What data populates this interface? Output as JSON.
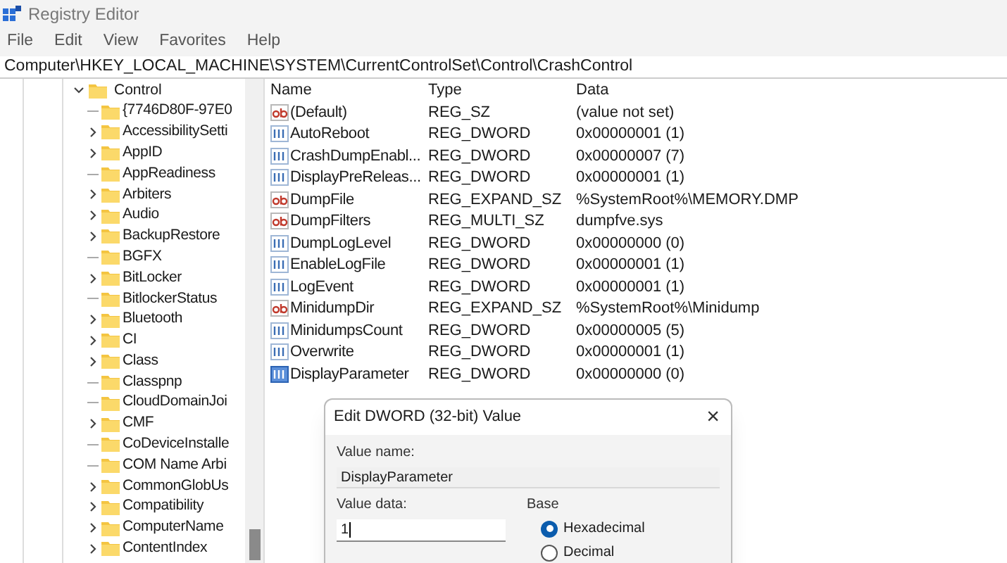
{
  "window": {
    "title": "Registry Editor"
  },
  "menu": [
    "File",
    "Edit",
    "View",
    "Favorites",
    "Help"
  ],
  "address": "Computer\\HKEY_LOCAL_MACHINE\\SYSTEM\\CurrentControlSet\\Control\\CrashControl",
  "tree": {
    "label": "Control",
    "expanded": true,
    "children": [
      {
        "label": "{7746D80F-97E0",
        "expandable": false
      },
      {
        "label": "AccessibilitySetti",
        "expandable": true
      },
      {
        "label": "AppID",
        "expandable": true
      },
      {
        "label": "AppReadiness",
        "expandable": false
      },
      {
        "label": "Arbiters",
        "expandable": true
      },
      {
        "label": "Audio",
        "expandable": true
      },
      {
        "label": "BackupRestore",
        "expandable": true
      },
      {
        "label": "BGFX",
        "expandable": false
      },
      {
        "label": "BitLocker",
        "expandable": true
      },
      {
        "label": "BitlockerStatus",
        "expandable": false
      },
      {
        "label": "Bluetooth",
        "expandable": true
      },
      {
        "label": "CI",
        "expandable": true
      },
      {
        "label": "Class",
        "expandable": true
      },
      {
        "label": "Classpnp",
        "expandable": false
      },
      {
        "label": "CloudDomainJoi",
        "expandable": false
      },
      {
        "label": "CMF",
        "expandable": true
      },
      {
        "label": "CoDeviceInstalle",
        "expandable": false
      },
      {
        "label": "COM Name Arbi",
        "expandable": false
      },
      {
        "label": "CommonGlobUs",
        "expandable": true
      },
      {
        "label": "Compatibility",
        "expandable": true
      },
      {
        "label": "ComputerName",
        "expandable": true
      },
      {
        "label": "ContentIndex",
        "expandable": true
      }
    ]
  },
  "table": {
    "columns": [
      "Name",
      "Type",
      "Data"
    ],
    "rows": [
      {
        "kind": "string",
        "name": "(Default)",
        "type": "REG_SZ",
        "data": "(value not set)",
        "selected": false
      },
      {
        "kind": "binary",
        "name": "AutoReboot",
        "type": "REG_DWORD",
        "data": "0x00000001 (1)",
        "selected": false
      },
      {
        "kind": "binary",
        "name": "CrashDumpEnabl...",
        "type": "REG_DWORD",
        "data": "0x00000007 (7)",
        "selected": false
      },
      {
        "kind": "binary",
        "name": "DisplayPreReleas...",
        "type": "REG_DWORD",
        "data": "0x00000001 (1)",
        "selected": false
      },
      {
        "kind": "string",
        "name": "DumpFile",
        "type": "REG_EXPAND_SZ",
        "data": "%SystemRoot%\\MEMORY.DMP",
        "selected": false
      },
      {
        "kind": "string",
        "name": "DumpFilters",
        "type": "REG_MULTI_SZ",
        "data": "dumpfve.sys",
        "selected": false
      },
      {
        "kind": "binary",
        "name": "DumpLogLevel",
        "type": "REG_DWORD",
        "data": "0x00000000 (0)",
        "selected": false
      },
      {
        "kind": "binary",
        "name": "EnableLogFile",
        "type": "REG_DWORD",
        "data": "0x00000001 (1)",
        "selected": false
      },
      {
        "kind": "binary",
        "name": "LogEvent",
        "type": "REG_DWORD",
        "data": "0x00000001 (1)",
        "selected": false
      },
      {
        "kind": "string",
        "name": "MinidumpDir",
        "type": "REG_EXPAND_SZ",
        "data": "%SystemRoot%\\Minidump",
        "selected": false
      },
      {
        "kind": "binary",
        "name": "MinidumpsCount",
        "type": "REG_DWORD",
        "data": "0x00000005 (5)",
        "selected": false
      },
      {
        "kind": "binary",
        "name": "Overwrite",
        "type": "REG_DWORD",
        "data": "0x00000001 (1)",
        "selected": false
      },
      {
        "kind": "binary",
        "name": "DisplayParameter",
        "type": "REG_DWORD",
        "data": "0x00000000 (0)",
        "selected": true
      }
    ]
  },
  "dialog": {
    "title": "Edit DWORD (32-bit) Value",
    "close": "×",
    "value_name_label": "Value name:",
    "value_name": "DisplayParameter",
    "value_data_label": "Value data:",
    "value_data": "1",
    "base_label": "Base",
    "base_options": [
      {
        "label": "Hexadecimal",
        "selected": true
      },
      {
        "label": "Decimal",
        "selected": false
      }
    ]
  }
}
